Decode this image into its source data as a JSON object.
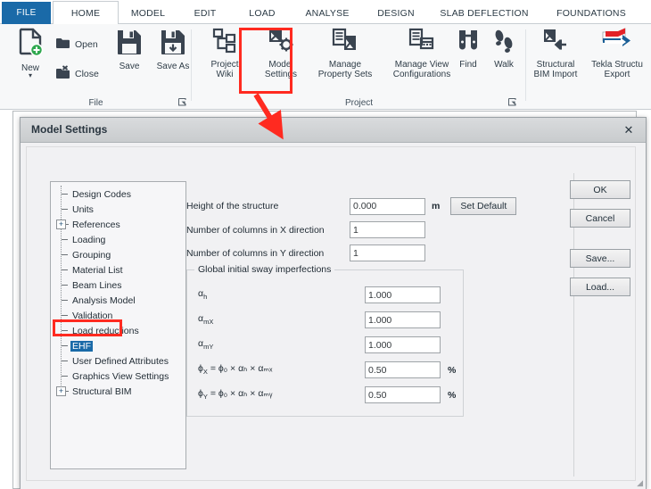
{
  "ribbon": {
    "tabs": [
      {
        "label": "FILE",
        "type": "file"
      },
      {
        "label": "HOME",
        "type": "active"
      },
      {
        "label": "MODEL",
        "type": "normal"
      },
      {
        "label": "EDIT",
        "type": "normal"
      },
      {
        "label": "LOAD",
        "type": "normal"
      },
      {
        "label": "ANALYSE",
        "type": "normal"
      },
      {
        "label": "DESIGN",
        "type": "normal"
      },
      {
        "label": "SLAB DEFLECTION",
        "type": "normal"
      },
      {
        "label": "FOUNDATIONS",
        "type": "normal"
      }
    ],
    "groups": [
      {
        "name": "File",
        "label": "File"
      },
      {
        "name": "Project",
        "label": "Project"
      }
    ],
    "buttons": {
      "new": "New",
      "open": "Open",
      "close": "Close",
      "save": "Save",
      "save_as": "Save As",
      "project_wiki": "Project\nWiki",
      "model_settings": "Model\nSettings",
      "manage_property_sets": "Manage\nProperty Sets",
      "manage_view_configurations": "Manage View\nConfigurations",
      "find": "Find",
      "walk": "Walk",
      "structural_bim_import": "Structural\nBIM Import",
      "tekla_structures_export": "Tekla Structu\nExport"
    },
    "icons": {
      "new": "new-document-icon",
      "open": "folder-open-icon",
      "close": "folder-close-icon",
      "save": "floppy-disk-icon",
      "save_as": "floppy-disk-download-icon",
      "project_wiki": "hierarchy-icon",
      "model_settings": "model-gear-icon",
      "manage_property_sets": "property-sets-icon",
      "manage_view_configurations": "view-configurations-icon",
      "find": "binoculars-icon",
      "walk": "footsteps-icon",
      "structural_bim_import": "bim-import-arrow-icon",
      "tekla_structures_export": "tekla-export-icon",
      "launcher": "dialog-launcher-icon"
    },
    "highlight_color": "#ff2a20",
    "accent_color": "#1a6aa8"
  },
  "dialog": {
    "title": "Model Settings",
    "close_label": "✕",
    "tree": [
      {
        "label": "Design Codes",
        "expandable": false,
        "selected": false
      },
      {
        "label": "Units",
        "expandable": false,
        "selected": false
      },
      {
        "label": "References",
        "expandable": true,
        "selected": false
      },
      {
        "label": "Loading",
        "expandable": false,
        "selected": false
      },
      {
        "label": "Grouping",
        "expandable": false,
        "selected": false
      },
      {
        "label": "Material List",
        "expandable": false,
        "selected": false
      },
      {
        "label": "Beam Lines",
        "expandable": false,
        "selected": false
      },
      {
        "label": "Analysis Model",
        "expandable": false,
        "selected": false
      },
      {
        "label": "Validation",
        "expandable": false,
        "selected": false
      },
      {
        "label": "Load reductions",
        "expandable": false,
        "selected": false
      },
      {
        "label": "EHF",
        "expandable": false,
        "selected": true
      },
      {
        "label": "User Defined Attributes",
        "expandable": false,
        "selected": false
      },
      {
        "label": "Graphics View Settings",
        "expandable": false,
        "selected": false
      },
      {
        "label": "Structural BIM",
        "expandable": true,
        "selected": false
      }
    ],
    "fields": [
      {
        "label": "Height of the structure",
        "value": "0.000",
        "unit": "m"
      },
      {
        "label": "Number of columns in X direction",
        "value": "1",
        "unit": ""
      },
      {
        "label": "Number of columns in Y direction",
        "value": "1",
        "unit": ""
      }
    ],
    "set_default_label": "Set Default",
    "groupbox": {
      "title": "Global initial sway imperfections",
      "rows": [
        {
          "sym": "α",
          "sub": "h",
          "eq": "",
          "value": "1.000",
          "unit": ""
        },
        {
          "sym": "α",
          "sub": "mX",
          "eq": "",
          "value": "1.000",
          "unit": ""
        },
        {
          "sym": "α",
          "sub": "mY",
          "eq": "",
          "value": "1.000",
          "unit": ""
        },
        {
          "sym": "ϕ",
          "sub": "X",
          "eq": " = ϕ₀ × αₕ × αₘₓ",
          "value": "0.50",
          "unit": "%"
        },
        {
          "sym": "ϕ",
          "sub": "Y",
          "eq": " = ϕ₀ × αₕ × αₘᵧ",
          "value": "0.50",
          "unit": "%"
        }
      ]
    },
    "buttons": {
      "ok": "OK",
      "cancel": "Cancel",
      "save": "Save...",
      "load": "Load..."
    }
  }
}
